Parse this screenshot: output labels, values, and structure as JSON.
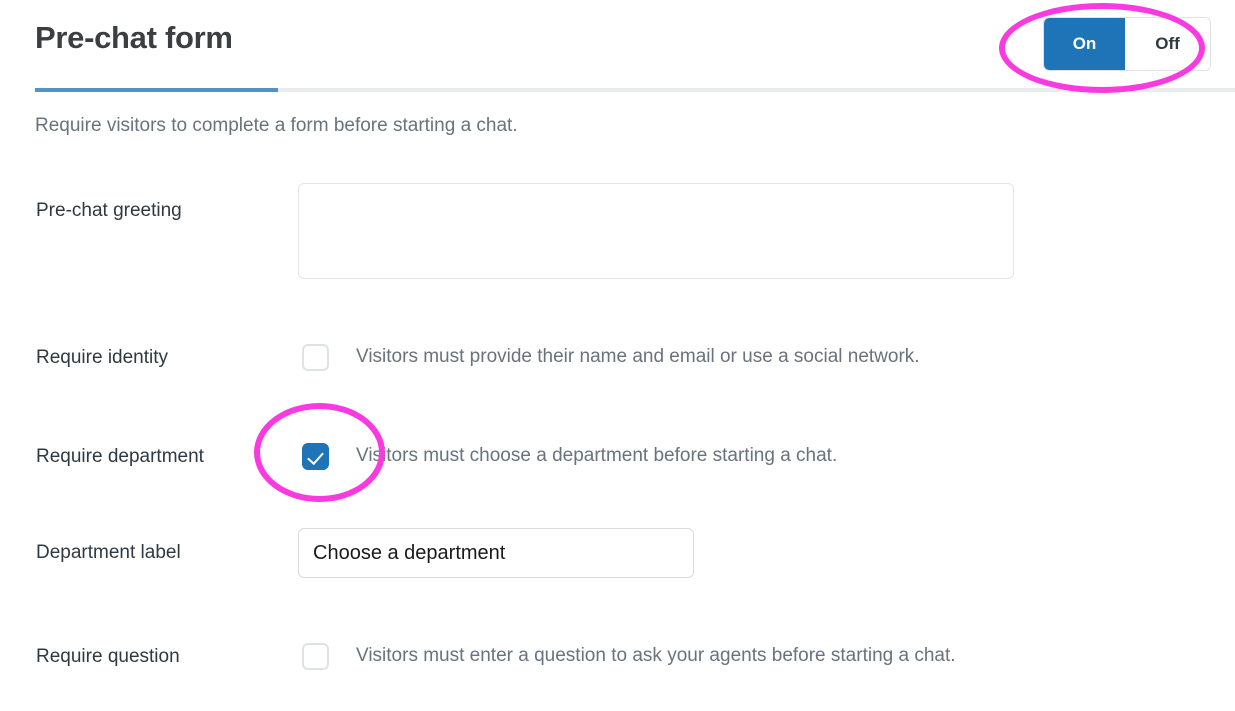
{
  "header": {
    "title": "Pre-chat form",
    "toggle": {
      "on_label": "On",
      "off_label": "Off",
      "selected": "On",
      "active_color": "#1f73b7"
    },
    "accent_color": "#5293c7"
  },
  "subtitle": "Require visitors to complete a form before starting a chat.",
  "rows": {
    "greeting": {
      "label": "Pre-chat greeting",
      "value": "",
      "placeholder": ""
    },
    "require_identity": {
      "label": "Require identity",
      "description": "Visitors must provide their name and email or use a social network.",
      "checked": false
    },
    "require_department": {
      "label": "Require department",
      "description": "Visitors must choose a department before starting a chat.",
      "checked": true
    },
    "department_label": {
      "label": "Department label",
      "value": "Choose a department",
      "placeholder": ""
    },
    "require_question": {
      "label": "Require question",
      "description": "Visitors must enter a question to ask your agents before starting a chat.",
      "checked": false
    }
  },
  "annotations": {
    "color": "#f93ae0",
    "shapes": [
      {
        "name": "toggle-highlight",
        "target": "On/Off toggle"
      },
      {
        "name": "checkbox-highlight",
        "target": "Require department checkbox"
      }
    ]
  }
}
